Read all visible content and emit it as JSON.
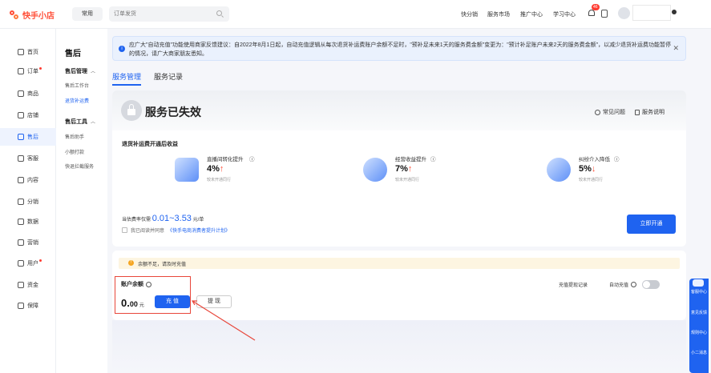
{
  "header": {
    "app_name": "快手小店",
    "common_label": "常用",
    "search_placeholder": "订单发货",
    "nav": [
      "快分销",
      "服务市场",
      "推广中心",
      "学习中心"
    ],
    "notification_count": "46"
  },
  "leftnav": {
    "items": [
      {
        "label": "首页",
        "dot": false
      },
      {
        "label": "订单",
        "dot": true
      },
      {
        "label": "商品",
        "dot": false
      },
      {
        "label": "店铺",
        "dot": false
      },
      {
        "label": "售后",
        "dot": false,
        "active": true
      },
      {
        "label": "客服",
        "dot": false
      },
      {
        "label": "内容",
        "dot": false
      },
      {
        "label": "分销",
        "dot": false
      },
      {
        "label": "数据",
        "dot": false
      },
      {
        "label": "营销",
        "dot": false
      },
      {
        "label": "用户",
        "dot": true
      },
      {
        "label": "资金",
        "dot": false
      },
      {
        "label": "保障",
        "dot": false
      }
    ]
  },
  "subnav": {
    "title": "售后",
    "group1": "售后管理",
    "group1_items": [
      "售后工作台",
      "退货补运费"
    ],
    "group2": "售后工具",
    "group2_items": [
      "售后助手",
      "小额打款",
      "快退拦截服务"
    ]
  },
  "notice": {
    "text": "应广大\"自动充值\"功能使用商家反馈建议：自2022年8月1日起，自动充值逻辑从每次退货补运费账户余额不足时，\"预补足未来1天的服务费金额\"变更为：\"预计补足账户未来2天的服务费金额\"，以减少退货补运费功能暂停的情况，请广大商家朋友悉知。"
  },
  "tabs": {
    "service_manage": "服务管理",
    "service_record": "服务记录"
  },
  "status": {
    "title": "服务已失效",
    "faq": "常见问题",
    "service_desc": "服务说明"
  },
  "benefits": {
    "title": "退货补运费开通后收益",
    "items": [
      {
        "title": "直播间转化提升",
        "value": "4%",
        "trend": "↑",
        "note": "较未开通同行"
      },
      {
        "title": "经营收益提升",
        "value": "7%",
        "trend": "↑",
        "note": "较未开通同行"
      },
      {
        "title": "纠纷介入降低",
        "value": "5%",
        "trend": "↓",
        "note": "较未开通同行"
      }
    ]
  },
  "rate": {
    "prefix": "当估费率仅需",
    "range": "0.01~3.53",
    "suffix": "元/单"
  },
  "agree": {
    "text": "我已阅读并同意",
    "link": "《快手电商消费者提升计划》"
  },
  "open_button": "立即开通",
  "account": {
    "warning": "余额不足，请及时充值",
    "balance_label": "账户余额",
    "balance_int": "0.",
    "balance_dec": "00",
    "unit": "元",
    "recharge": "充 值",
    "withdraw": "提 现",
    "recharge_record": "充值提现记录",
    "auto_recharge": "自动充值"
  },
  "float": [
    "客服中心",
    "意见反馈",
    "规则中心",
    "小二消息"
  ]
}
